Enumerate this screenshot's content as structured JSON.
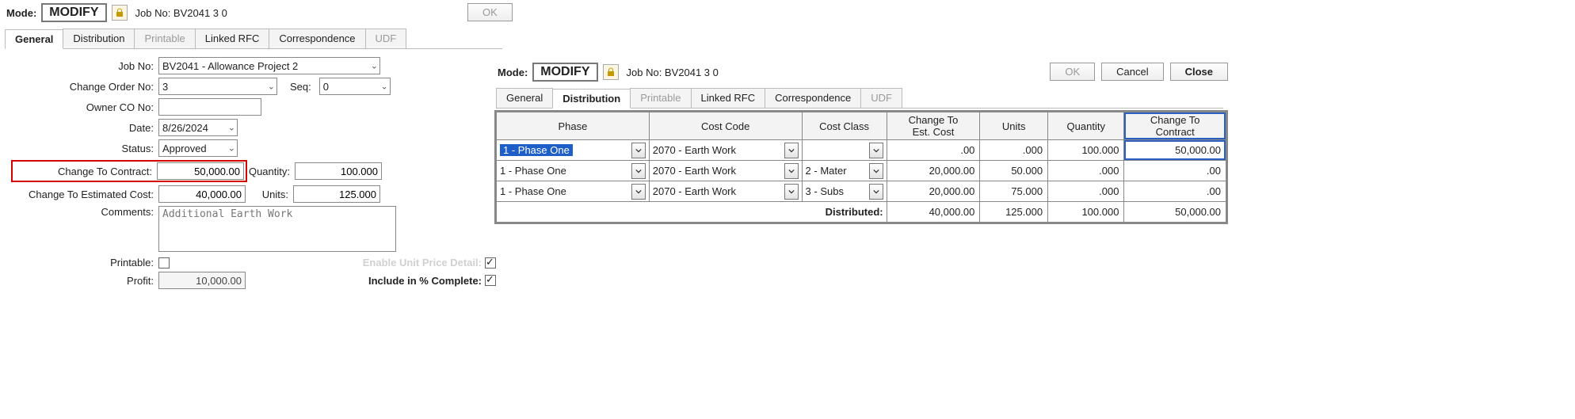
{
  "left": {
    "mode_label": "Mode:",
    "mode_value": "MODIFY",
    "jobno_label": "Job No: BV2041  3  0",
    "ok_label": "OK",
    "tabs": {
      "general": "General",
      "distribution": "Distribution",
      "printable": "Printable",
      "linked_rfc": "Linked RFC",
      "correspondence": "Correspondence",
      "udf": "UDF"
    },
    "form": {
      "jobno_label": "Job No:",
      "jobno_value": "BV2041 - Allowance Project 2",
      "co_label": "Change Order No:",
      "co_value": "3",
      "seq_label": "Seq:",
      "seq_value": "0",
      "owner_label": "Owner CO No:",
      "owner_value": "",
      "date_label": "Date:",
      "date_value": "8/26/2024",
      "status_label": "Status:",
      "status_value": "Approved",
      "ctc_label": "Change To Contract:",
      "ctc_value": "50,000.00",
      "qty_label": "Quantity:",
      "qty_value": "100.000",
      "ctec_label": "Change To Estimated Cost:",
      "ctec_value": "40,000.00",
      "units_label": "Units:",
      "units_value": "125.000",
      "comments_label": "Comments:",
      "comments_value": "Additional Earth Work",
      "printable_label": "Printable:",
      "enable_upd_label": "Enable Unit Price Detail:",
      "profit_label": "Profit:",
      "profit_value": "10,000.00",
      "include_pc_label": "Include in % Complete:"
    }
  },
  "right": {
    "mode_label": "Mode:",
    "mode_value": "MODIFY",
    "jobno_label": "Job No: BV2041  3  0",
    "ok_label": "OK",
    "cancel_label": "Cancel",
    "close_label": "Close",
    "tabs": {
      "general": "General",
      "distribution": "Distribution",
      "printable": "Printable",
      "linked_rfc": "Linked RFC",
      "correspondence": "Correspondence",
      "udf": "UDF"
    },
    "cols": {
      "phase": "Phase",
      "costcode": "Cost Code",
      "costclass": "Cost Class",
      "ctec": "Change To\nEst. Cost",
      "units": "Units",
      "qty": "Quantity",
      "ctc": "Change To\nContract"
    },
    "rows": [
      {
        "phase": "1  - Phase One",
        "phase_hl": true,
        "code": "2070  - Earth Work",
        "cls": "",
        "ctec": ".00",
        "units": ".000",
        "qty": "100.000",
        "ctc": "50,000.00"
      },
      {
        "phase": "1  - Phase One",
        "phase_hl": false,
        "code": "2070  - Earth Work",
        "cls": "2  - Mater",
        "ctec": "20,000.00",
        "units": "50.000",
        "qty": ".000",
        "ctc": ".00"
      },
      {
        "phase": "1  - Phase One",
        "phase_hl": false,
        "code": "2070  - Earth Work",
        "cls": "3  - Subs",
        "ctec": "20,000.00",
        "units": "75.000",
        "qty": ".000",
        "ctc": ".00"
      }
    ],
    "totals": {
      "label": "Distributed:",
      "ctec": "40,000.00",
      "units": "125.000",
      "qty": "100.000",
      "ctc": "50,000.00"
    }
  }
}
